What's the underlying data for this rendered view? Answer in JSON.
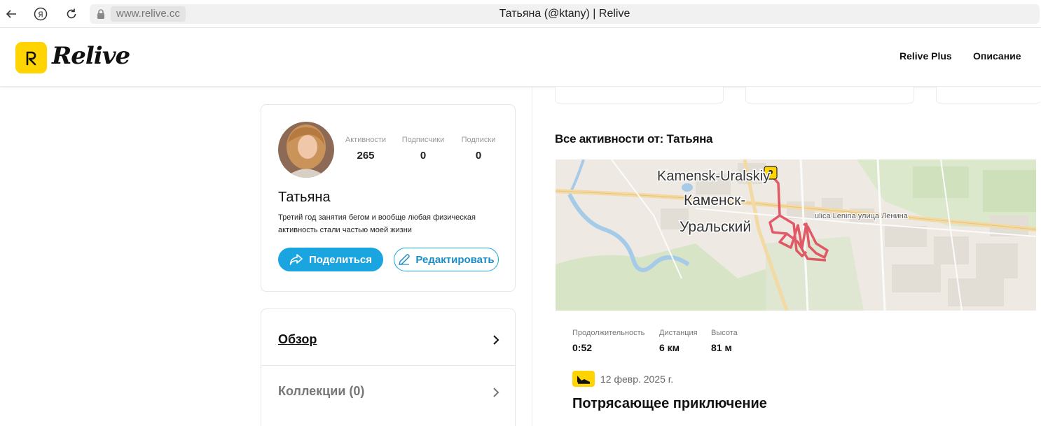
{
  "browser": {
    "url": "www.relive.cc",
    "tab_title": "Татьяна (@ktany) | Relive"
  },
  "header": {
    "logo_text": "Relive",
    "links": [
      "Relive Plus",
      "Описание"
    ]
  },
  "profile": {
    "name": "Татьяна",
    "bio": "Третий год занятия бегом и вообще любая физическая активность стали частью моей жизни",
    "stats": [
      {
        "label": "Активности",
        "value": "265"
      },
      {
        "label": "Подписчики",
        "value": "0"
      },
      {
        "label": "Подписки",
        "value": "0"
      }
    ],
    "share_label": "Поделиться",
    "edit_label": "Редактировать"
  },
  "menu": {
    "overview_label": "Обзор",
    "collections_label": "Коллекции (0)"
  },
  "activities": {
    "section_title": "Все активности от: Татьяна",
    "map_labels": {
      "city_latin": "Kamensk-Uralskiy",
      "city_ru_line1": "Каменск-",
      "city_ru_line2": "Уральский",
      "street": "ulica Lenina улица Ленина"
    },
    "metrics": [
      {
        "label": "Продолжительность",
        "value": "0:52"
      },
      {
        "label": "Дистанция",
        "value": "6 км"
      },
      {
        "label": "Высота",
        "value": "81 м"
      }
    ],
    "date": "12 февр. 2025 г.",
    "title": "Потрясающее приключение"
  },
  "colors": {
    "brand_yellow": "#ffd400",
    "accent_blue": "#1aa4e0",
    "route_red": "#e04a5a"
  }
}
